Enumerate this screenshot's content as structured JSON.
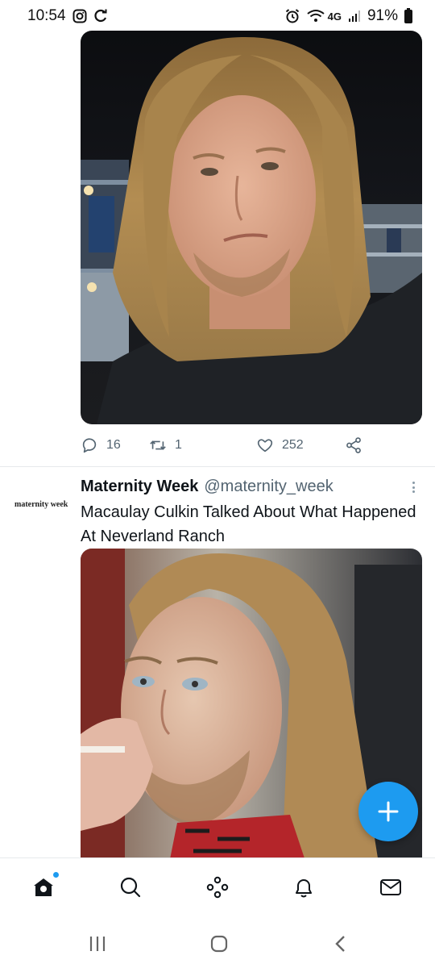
{
  "status_bar": {
    "time": "10:54",
    "network": "4G",
    "battery_percent": "91%"
  },
  "tweet1": {
    "media_description_icon": "photo",
    "actions": {
      "reply_count": "16",
      "retweet_count": "1",
      "like_count": "252"
    }
  },
  "tweet2": {
    "avatar_text": "maternity week",
    "display_name": "Maternity Week",
    "handle": "@maternity_week",
    "text": "Macaulay Culkin Talked About What Happened At Neverland Ranch"
  },
  "bottom_nav": {
    "items": [
      "home-icon",
      "search-icon",
      "spaces-icon",
      "notifications-icon",
      "messages-icon"
    ],
    "home_has_badge": true
  },
  "colors": {
    "accent": "#1d9bf0",
    "secondary_text": "#536471"
  }
}
